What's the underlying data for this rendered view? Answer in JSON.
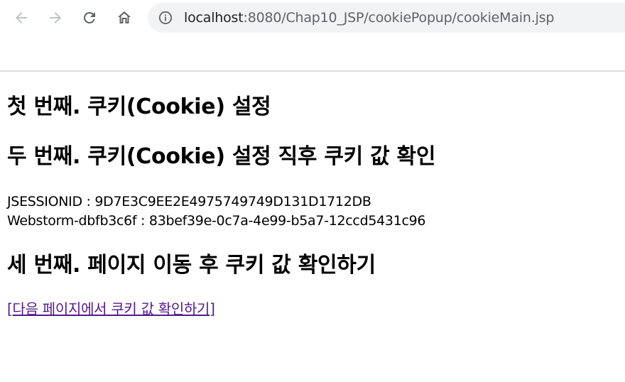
{
  "browser": {
    "back_icon": "arrow-left-icon",
    "forward_icon": "arrow-right-icon",
    "reload_icon": "reload-icon",
    "home_icon": "home-icon",
    "site_info_icon": "info-icon",
    "url_host": "localhost",
    "url_rest": ":8080/Chap10_JSP/cookiePopup/cookieMain.jsp"
  },
  "page": {
    "heading_1": "첫 번째. 쿠키(Cookie) 설정",
    "heading_2": "두 번째. 쿠키(Cookie) 설정 직후 쿠키 값 확인",
    "cookies": [
      {
        "text": "JSESSIONID : 9D7E3C9EE2E4975749749D131D1712DB"
      },
      {
        "text": "Webstorm-dbfb3c6f : 83bef39e-0c7a-4e99-b5a7-12ccd5431c96"
      }
    ],
    "heading_3": "세 번째. 페이지 이동 후 쿠키 값 확인하기",
    "link_open": "[",
    "link_text": "다음 페이지에서 쿠키 값 확인하기",
    "link_close": "]"
  },
  "colors": {
    "link_visited": "#551a8b",
    "omnibox_bg": "#f1f3f4",
    "icon_gray": "#5f6368",
    "icon_disabled": "#bdc1c6"
  }
}
